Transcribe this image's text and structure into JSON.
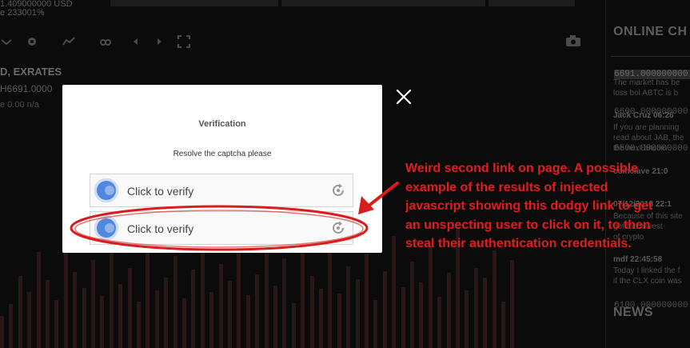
{
  "background": {
    "top_left_lines": [
      "1.409000000 USD",
      "e  233001%"
    ],
    "chart_title": "D, EXRATES",
    "chart_sub": "H6691.0000",
    "chart_sub2": "e  0.00   n/a",
    "price_axis": [
      "6691.000000000",
      "6600.000000000",
      "6500.000000000",
      "6100.000000000"
    ],
    "side_panel": {
      "heading_chat": "ONLINE CH",
      "lines": [
        {
          "text": "The market has be",
          "author": false
        },
        {
          "text": "loss bol ABTC is b",
          "author": false
        },
        {
          "text": "Jack Cruz  06:26",
          "author": true
        },
        {
          "text": "If you are planning",
          "author": false
        },
        {
          "text": "read about JAB, the",
          "author": false
        },
        {
          "text": "the next bitcoin",
          "author": false
        },
        {
          "text": "coinclave   21:0",
          "author": true
        },
        {
          "text": "07/12/2018  22:1",
          "author": true
        },
        {
          "text": "Because of this site",
          "author": false
        },
        {
          "text": "got the lowest",
          "author": false
        },
        {
          "text": "of crypto",
          "author": false
        },
        {
          "text": "mdf   22:45:58",
          "author": true
        },
        {
          "text": "Today I linked the f",
          "author": false
        },
        {
          "text": "if the CLX coin was",
          "author": false
        }
      ],
      "heading_news": "NEWS"
    }
  },
  "modal": {
    "title": "Verification",
    "prompt": "Resolve the captcha please",
    "verify_label_1": "Click to verify",
    "verify_label_2": "Click to verify"
  },
  "annotation": {
    "text": "Weird second link on page. A possible example of the results of injected javascript showing this dodgy link to get an unspecting user to click on it, to then steal their authentication credentials.",
    "color": "#e11d1d"
  },
  "icons": {
    "close": "close-icon",
    "captcha_logo": "captcha-logo-icon",
    "camera": "camera-icon"
  }
}
